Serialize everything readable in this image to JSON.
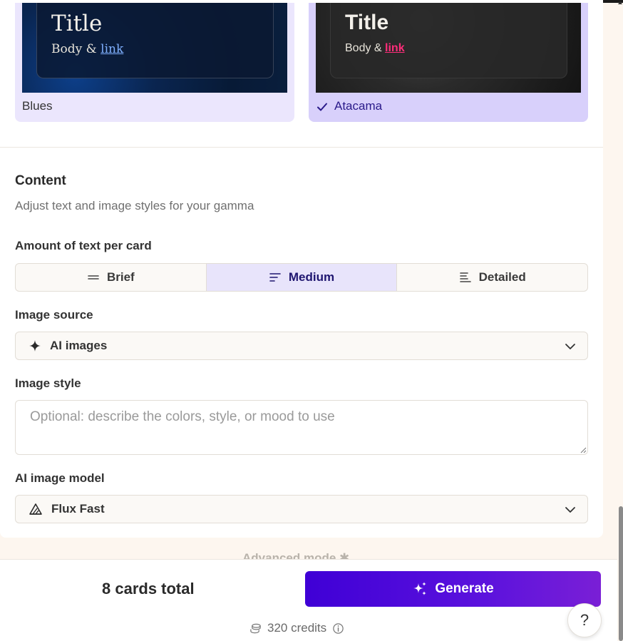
{
  "themes": [
    {
      "name": "Blues",
      "preview_title": "Title",
      "preview_body": "Body & ",
      "preview_link": "link",
      "selected": false
    },
    {
      "name": "Atacama",
      "preview_title": "Title",
      "preview_body": "Body & ",
      "preview_link": "link",
      "selected": true
    }
  ],
  "content": {
    "title": "Content",
    "subtitle": "Adjust text and image styles for your gamma"
  },
  "text_amount": {
    "label": "Amount of text per card",
    "options": [
      "Brief",
      "Medium",
      "Detailed"
    ],
    "selected": "Medium"
  },
  "image_source": {
    "label": "Image source",
    "value": "AI images",
    "icon": "sparkle-icon"
  },
  "image_style": {
    "label": "Image style",
    "placeholder": "Optional: describe the colors, style, or mood to use"
  },
  "image_model": {
    "label": "AI image model",
    "value": "Flux Fast",
    "icon": "flux-icon"
  },
  "advanced_mode": {
    "label": "Advanced mode"
  },
  "footer": {
    "cards_total": "8 cards total",
    "generate_label": "Generate",
    "credits": "320 credits",
    "help": "?"
  },
  "colors": {
    "accent": "#4a0ad8",
    "selected_bg": "#e8e4fb",
    "link_blues": "#7fb0ff",
    "link_atacama": "#ff2d7a"
  }
}
